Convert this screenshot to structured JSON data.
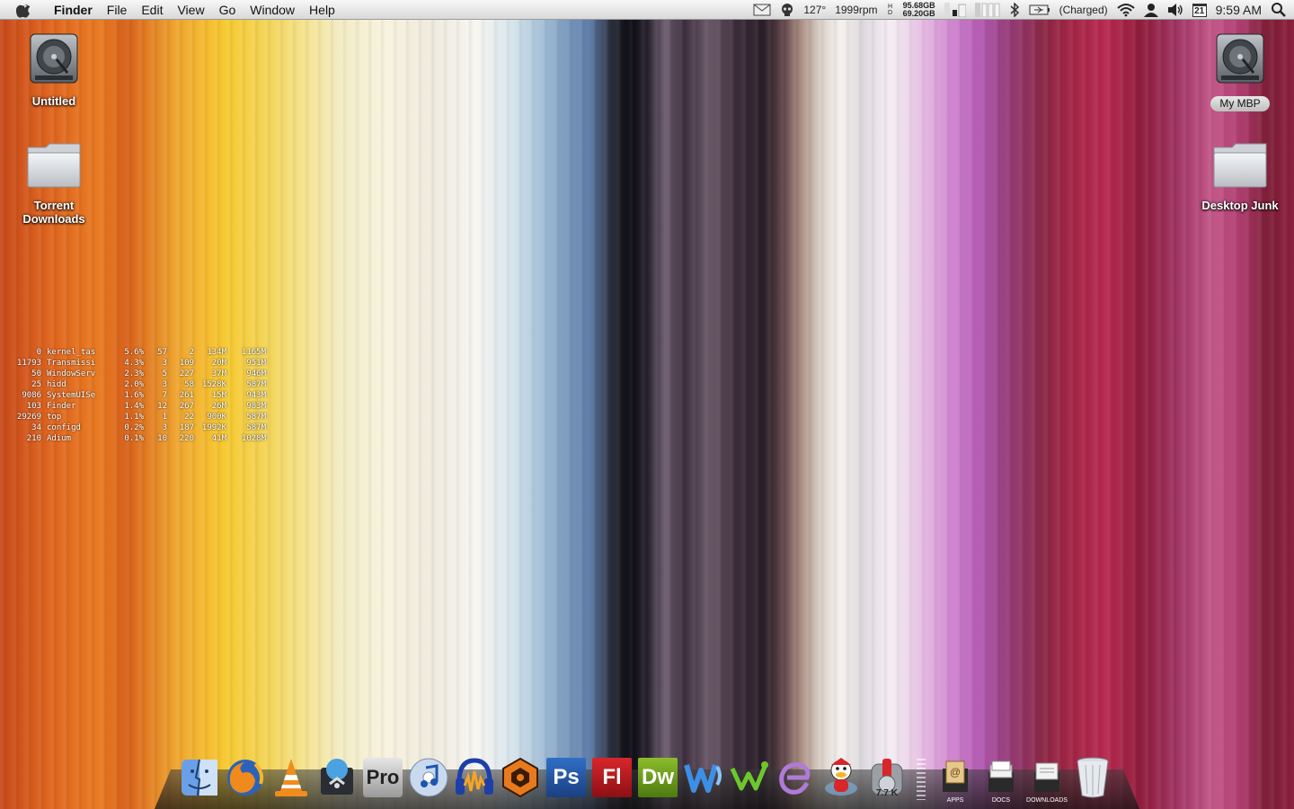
{
  "menubar": {
    "app_name": "Finder",
    "menus": [
      "File",
      "Edit",
      "View",
      "Go",
      "Window",
      "Help"
    ],
    "status": {
      "temperature": "127°",
      "fan_speed": "1999rpm",
      "disk_used": "95.68GB",
      "disk_free": "69.20GB",
      "battery_status": "(Charged)",
      "calendar_day": "21",
      "clock": "9:59 AM"
    }
  },
  "desktop": {
    "left_icons": [
      {
        "label": "Untitled",
        "icon": "hard-drive-icon"
      },
      {
        "label": "Torrent Downloads",
        "icon": "folder-icon"
      }
    ],
    "right_icons": [
      {
        "label": "My MBP",
        "icon": "hard-drive-icon"
      },
      {
        "label": "Desktop Junk",
        "icon": "folder-icon"
      }
    ]
  },
  "top_processes": [
    [
      "0",
      "kernel_tas",
      "5.6%",
      "57",
      "2",
      "134M",
      "1165M"
    ],
    [
      "11793",
      "Transmissi",
      "4.3%",
      "3",
      "109",
      "20M",
      "951M"
    ],
    [
      "50",
      "WindowServ",
      "2.3%",
      "5",
      "227",
      "37M",
      "946M"
    ],
    [
      "25",
      "hidd",
      "2.0%",
      "3",
      "58",
      "1528K",
      "587M"
    ],
    [
      "9086",
      "SystemUISe",
      "1.6%",
      "7",
      "261",
      "15M",
      "943M"
    ],
    [
      "103",
      "Finder",
      "1.4%",
      "12",
      "267",
      "26M",
      "983M"
    ],
    [
      "29269",
      "top",
      "1.1%",
      "1",
      "22",
      "900K",
      "587M"
    ],
    [
      "34",
      "configd",
      "0.2%",
      "3",
      "187",
      "1992K",
      "587M"
    ],
    [
      "210",
      "Adium",
      "0.1%",
      "10",
      "220",
      "41M",
      "1028M"
    ]
  ],
  "dock": {
    "apps": [
      "Finder",
      "Firefox",
      "VLC",
      "Network Utility",
      "Logic Pro",
      "iTunes",
      "Audacity",
      "Reason",
      "Ps",
      "Fl",
      "Dw",
      "Word",
      "Mojo",
      "Emacs",
      "Adium",
      "Transmission"
    ],
    "transmission_badge": "7.7 K",
    "stacks": [
      "APPS",
      "DOCS",
      "DOWNLOADS"
    ],
    "trash": "Trash"
  }
}
